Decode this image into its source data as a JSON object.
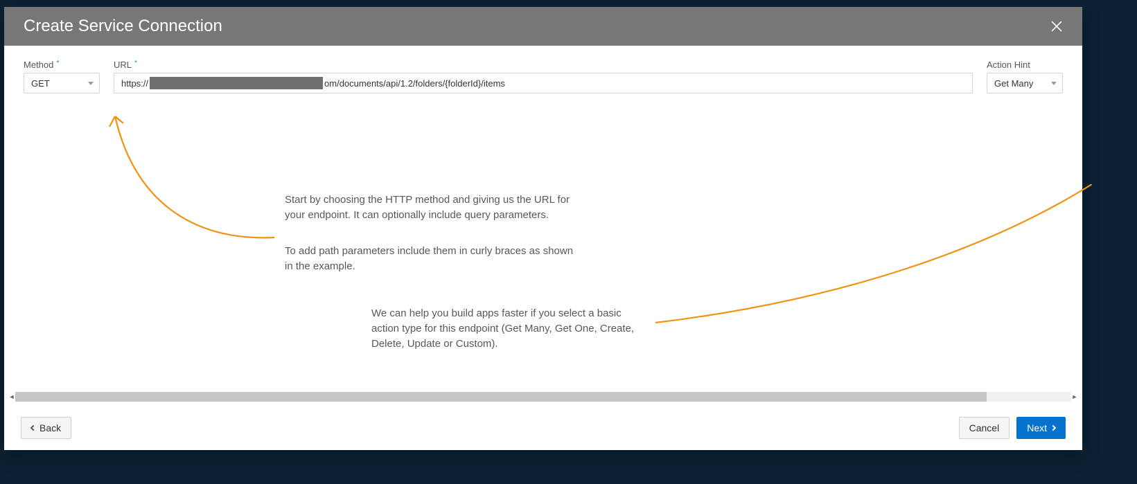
{
  "header": {
    "title": "Create Service Connection"
  },
  "form": {
    "method": {
      "label": "Method",
      "value": "GET"
    },
    "url": {
      "label": "URL",
      "prefix": "https://",
      "suffix": "om/documents/api/1.2/folders/{folderId}/items"
    },
    "actionHint": {
      "label": "Action Hint",
      "value": "Get Many"
    }
  },
  "hints": {
    "p1": "Start by choosing the HTTP method and giving us the URL for your endpoint. It can optionally include query parameters.",
    "p2": "To add path parameters include them in curly braces as shown in the example.",
    "p3": "We can help you build apps faster if you select a basic action type for this endpoint (Get Many, Get One, Create, Delete, Update or Custom)."
  },
  "footer": {
    "back": "Back",
    "cancel": "Cancel",
    "next": "Next"
  }
}
